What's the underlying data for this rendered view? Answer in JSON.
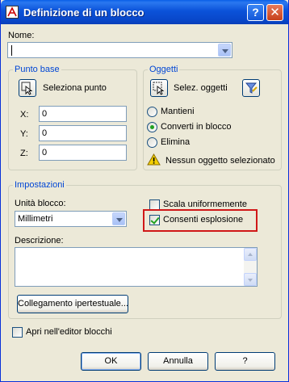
{
  "window": {
    "title": "Definizione di un blocco",
    "help_label": "?",
    "close_label": "✕"
  },
  "name": {
    "label": "Nome:",
    "value": ""
  },
  "base_point": {
    "title": "Punto base",
    "pick_label": "Seleziona punto",
    "x_label": "X:",
    "x_value": "0",
    "y_label": "Y:",
    "y_value": "0",
    "z_label": "Z:",
    "z_value": "0"
  },
  "objects": {
    "title": "Oggetti",
    "select_label": "Selez. oggetti",
    "options": [
      {
        "label": "Mantieni",
        "selected": false
      },
      {
        "label": "Converti in blocco",
        "selected": true
      },
      {
        "label": "Elimina",
        "selected": false
      }
    ],
    "warning": "Nessun oggetto selezionato"
  },
  "settings": {
    "title": "Impostazioni",
    "unit_label": "Unità blocco:",
    "unit_value": "Millimetri",
    "scale_uniform_label": "Scala uniformemente",
    "scale_uniform_checked": false,
    "allow_explode_label": "Consenti esplosione",
    "allow_explode_checked": true,
    "description_label": "Descrizione:",
    "description_value": "",
    "hyperlink_label": "Collegamento ipertestuale..."
  },
  "open_in_editor": {
    "label": "Apri nell'editor blocchi",
    "checked": false
  },
  "buttons": {
    "ok": "OK",
    "cancel": "Annulla",
    "help": "?"
  },
  "colors": {
    "titlebar": "#0a52d9",
    "dialog_bg": "#ece9d8",
    "group_title": "#0046d5",
    "highlight": "#d01818",
    "radio_dot": "#21a121"
  }
}
